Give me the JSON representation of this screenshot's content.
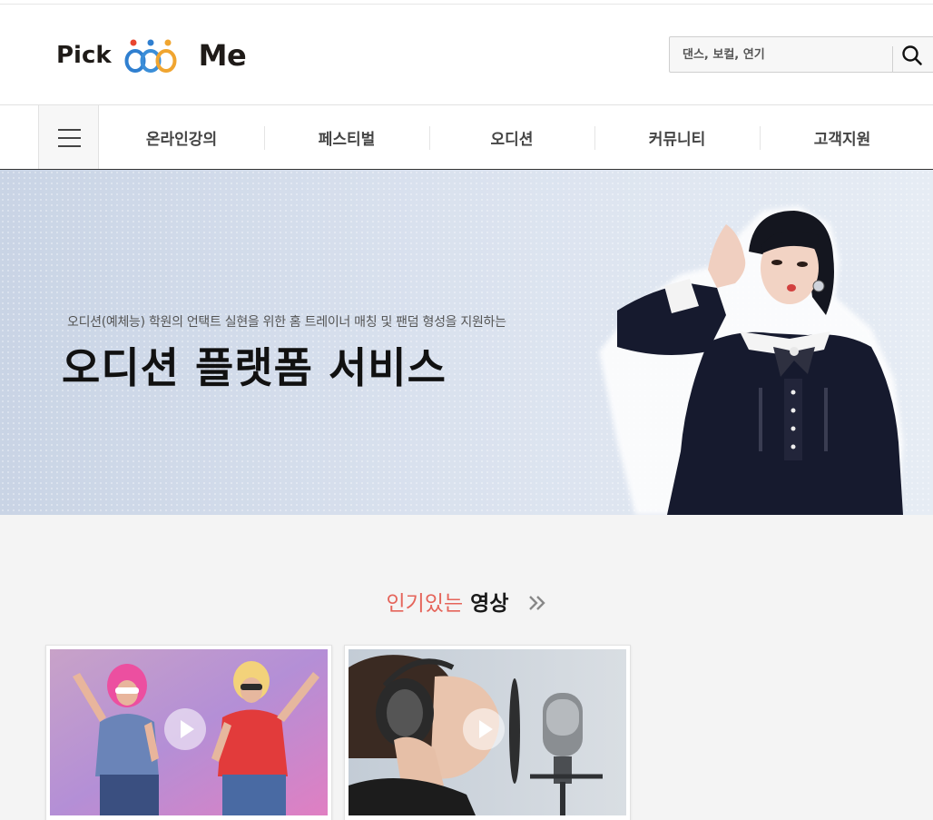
{
  "header": {
    "logo": {
      "pick": "Pick",
      "me": "Me"
    },
    "search": {
      "placeholder": "댄스, 보컬, 연기",
      "icon": "search-icon"
    }
  },
  "nav": {
    "menu_icon": "hamburger-menu-icon",
    "items": [
      {
        "label": "온라인강의"
      },
      {
        "label": "페스티벌"
      },
      {
        "label": "오디션"
      },
      {
        "label": "커뮤니티"
      },
      {
        "label": "고객지원"
      }
    ]
  },
  "hero": {
    "subtitle": "오디션(예체능) 학원의 언택트 실현을 위한 홈 트레이너 매칭 및 팬덤 형성을 지원하는",
    "title": "오디션 플랫폼 서비스"
  },
  "popular": {
    "title_accent": "인기있는",
    "title_strong": "영상",
    "more_icon": "double-chevron-right-icon",
    "videos": [
      {
        "thumb": "dancers-thumbnail",
        "play_icon": "play-icon"
      },
      {
        "thumb": "singer-microphone-thumbnail",
        "play_icon": "play-icon"
      }
    ]
  },
  "colors": {
    "accent": "#e5645a",
    "logo_blue": "#2f7fd0",
    "logo_orange": "#f0a530",
    "text_dark": "#1a1a1a"
  }
}
